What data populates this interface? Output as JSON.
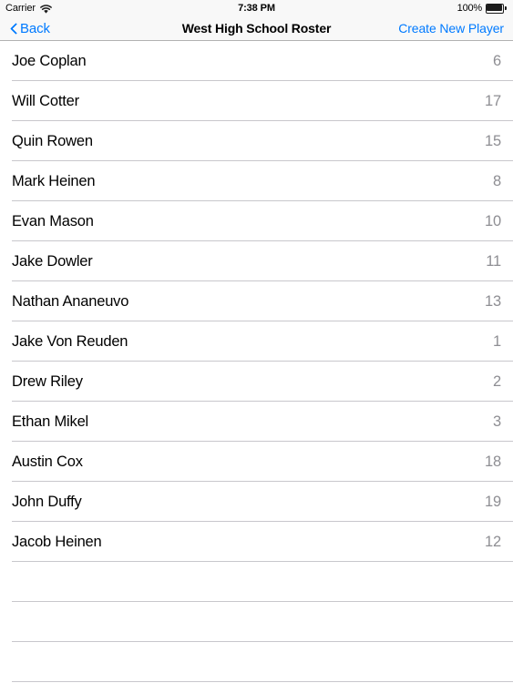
{
  "status_bar": {
    "carrier": "Carrier",
    "wifi_icon": "wifi-icon",
    "time": "7:38 PM",
    "battery_percent": "100%",
    "battery_icon": "battery-full-icon"
  },
  "nav_bar": {
    "back_label": "Back",
    "back_icon": "chevron-left-icon",
    "title": "West High School Roster",
    "action_label": "Create New Player",
    "tint_color": "#007aff"
  },
  "roster": {
    "players": [
      {
        "name": "Joe Coplan",
        "number": "6"
      },
      {
        "name": "Will Cotter",
        "number": "17"
      },
      {
        "name": "Quin Rowen",
        "number": "15"
      },
      {
        "name": "Mark Heinen",
        "number": "8"
      },
      {
        "name": "Evan Mason",
        "number": "10"
      },
      {
        "name": "Jake Dowler",
        "number": "11"
      },
      {
        "name": "Nathan Ananeuvo",
        "number": "13"
      },
      {
        "name": "Jake Von Reuden",
        "number": "1"
      },
      {
        "name": "Drew Riley",
        "number": "2"
      },
      {
        "name": "Ethan Mikel",
        "number": "3"
      },
      {
        "name": "Austin Cox",
        "number": "18"
      },
      {
        "name": "John Duffy",
        "number": "19"
      },
      {
        "name": "Jacob Heinen",
        "number": "12"
      }
    ],
    "empty_rows": 3
  },
  "colors": {
    "separator": "#c8c7cc",
    "secondary_text": "#8e8e93",
    "nav_background": "#f8f8f8"
  }
}
